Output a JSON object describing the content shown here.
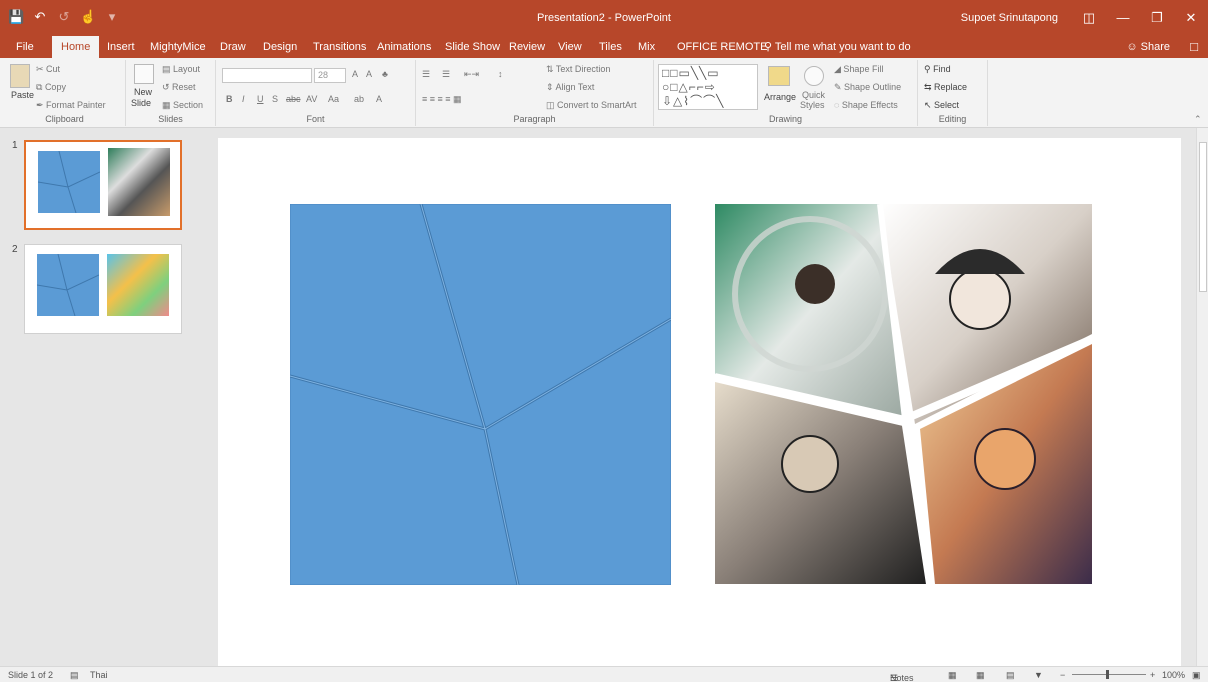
{
  "window": {
    "title": "Presentation2 - PowerPoint",
    "user": "Supoet Srinutapong",
    "qat_icons": [
      "save-icon",
      "undo-icon",
      "redo-icon",
      "touch-mode-icon",
      "customize-icon"
    ]
  },
  "tabs": [
    "File",
    "Home",
    "Insert",
    "MightyMice",
    "Draw",
    "Design",
    "Transitions",
    "Animations",
    "Slide Show",
    "Review",
    "View",
    "Tiles",
    "Mix",
    "OFFICE REMOTE"
  ],
  "active_tab": "Home",
  "tell_me": "Tell me what you want to do",
  "share": "Share",
  "ribbon": {
    "clipboard": {
      "paste": "Paste",
      "cut": "Cut",
      "copy": "Copy",
      "format_painter": "Format Painter",
      "label": "Clipboard"
    },
    "slides": {
      "new_slide_1": "New",
      "new_slide_2": "Slide",
      "layout": "Layout",
      "reset": "Reset",
      "section": "Section",
      "label": "Slides"
    },
    "font": {
      "size": "28",
      "bold": "B",
      "italic": "I",
      "underline": "U",
      "shadow": "S",
      "strike": "abc",
      "case": "Aa",
      "grow": "A",
      "shrink": "A",
      "label": "Font"
    },
    "paragraph": {
      "text_direction": "Text Direction",
      "align_text": "Align Text",
      "convert_smartart": "Convert to SmartArt",
      "label": "Paragraph"
    },
    "drawing": {
      "arrange": "Arrange",
      "quick_styles_1": "Quick",
      "quick_styles_2": "Styles",
      "shape_fill": "Shape Fill",
      "shape_outline": "Shape Outline",
      "shape_effects": "Shape Effects",
      "label": "Drawing"
    },
    "editing": {
      "find": "Find",
      "replace": "Replace",
      "select": "Select",
      "label": "Editing"
    }
  },
  "thumbnails": [
    "1",
    "2"
  ],
  "status": {
    "slide_info": "Slide 1 of 2",
    "language": "Thai",
    "notes": "Notes",
    "zoom": "100%"
  },
  "colors": {
    "accent": "#b7472a",
    "shape_blue": "#5b9bd5",
    "selection": "#e2702a"
  }
}
